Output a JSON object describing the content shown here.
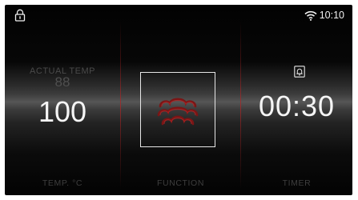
{
  "status_bar": {
    "time": "10:10",
    "lock_icon": "padlock-icon",
    "wifi_icon": "wifi-icon"
  },
  "temperature": {
    "actual_label": "ACTUAL TEMP",
    "actual_value": "88",
    "set_value": "100",
    "label": "TEMP. °C"
  },
  "function": {
    "icon": "steam-clouds-icon",
    "label": "FUNCTION"
  },
  "timer": {
    "icon": "bell-icon",
    "value": "00:30",
    "label": "TIMER"
  },
  "colors": {
    "accent_red": "#8a1c1c",
    "text_primary": "#f5f5f5",
    "text_dim": "#4a4a4a"
  }
}
